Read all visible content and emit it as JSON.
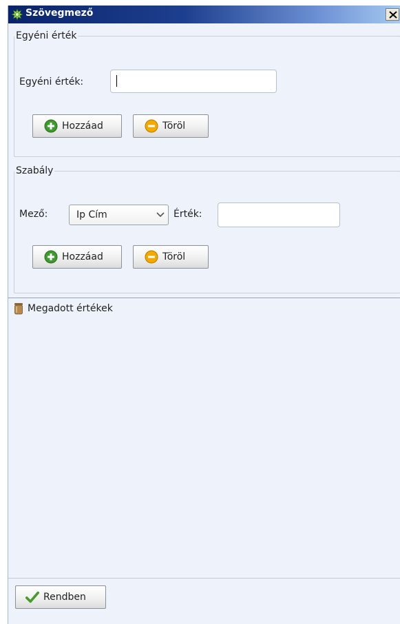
{
  "window": {
    "title": "Szövegmező",
    "close_label": "X"
  },
  "custom_value": {
    "legend": "Egyéni érték",
    "field_label": "Egyéni érték:",
    "field_value": "",
    "add_button": "Hozzáad",
    "delete_button": "Töröl"
  },
  "rule": {
    "legend": "Szabály",
    "field_label": "Mező:",
    "field_selected": "Ip Cím",
    "value_label": "Érték:",
    "value_field": "",
    "add_button": "Hozzáad",
    "delete_button": "Töröl"
  },
  "values_list": {
    "header": "Megadott értékek",
    "items": []
  },
  "footer": {
    "ok_button": "Rendben"
  },
  "colors": {
    "titlebar_start": "#0a246a",
    "titlebar_end": "#a6caf0",
    "add_icon": "#3f9a2e",
    "delete_icon": "#f2a900",
    "ok_check": "#4a9a2a"
  },
  "icons": {
    "title": "gear-icon",
    "add": "plus-circle-icon",
    "delete": "minus-circle-icon",
    "list": "jar-icon",
    "ok": "checkmark-icon",
    "dropdown": "chevron-down-icon"
  }
}
